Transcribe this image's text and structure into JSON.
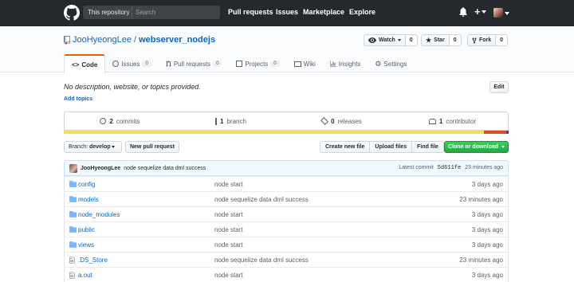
{
  "header": {
    "search_scope": "This repository",
    "search_placeholder": "Search",
    "nav": [
      "Pull requests",
      "Issues",
      "Marketplace",
      "Explore"
    ],
    "plus": "+"
  },
  "repo": {
    "owner": "JooHyeongLee",
    "separator": "/",
    "name": "webserver_nodejs",
    "watch_label": "Watch",
    "watch_count": "0",
    "star_label": "Star",
    "star_count": "0",
    "fork_label": "Fork",
    "fork_count": "0"
  },
  "tabs": [
    {
      "label": "Code",
      "icon": "code-icon",
      "counter": ""
    },
    {
      "label": "Issues",
      "icon": "issue-icon",
      "counter": "0"
    },
    {
      "label": "Pull requests",
      "icon": "pull-request-icon",
      "counter": "0"
    },
    {
      "label": "Projects",
      "icon": "project-icon",
      "counter": "0"
    },
    {
      "label": "Wiki",
      "icon": "book-icon",
      "counter": ""
    },
    {
      "label": "Insights",
      "icon": "graph-icon",
      "counter": ""
    },
    {
      "label": "Settings",
      "icon": "gear-icon",
      "counter": ""
    }
  ],
  "description": "No description, website, or topics provided.",
  "add_topics": "Add topics",
  "edit_label": "Edit",
  "summary": {
    "commits_num": "2",
    "commits_label": "commits",
    "branches_num": "1",
    "branches_label": "branch",
    "releases_num": "0",
    "releases_label": "releases",
    "contributors_num": "1",
    "contributors_label": "contributor"
  },
  "languages": [
    {
      "color": "#f1e05a",
      "share": 0.945
    },
    {
      "color": "#e34c26",
      "share": 0.05
    },
    {
      "color": "#563d7c",
      "share": 0.005
    }
  ],
  "file_nav": {
    "branch_prefix": "Branch:",
    "branch_name": "develop",
    "new_pr": "New pull request",
    "create_file": "Create new file",
    "upload_files": "Upload files",
    "find_file": "Find file",
    "clone": "Clone or download"
  },
  "commit": {
    "author": "JooHyeongLee",
    "message": "node sequelize data dml success",
    "latest_label": "Latest commit",
    "sha": "5d611fe",
    "age": "23 minutes ago"
  },
  "files": [
    {
      "name": "config",
      "type": "dir",
      "message": "node start",
      "age": "3 days ago"
    },
    {
      "name": "models",
      "type": "dir",
      "message": "node sequelize data dml success",
      "age": "23 minutes ago"
    },
    {
      "name": "node_modules",
      "type": "dir",
      "message": "node start",
      "age": "3 days ago"
    },
    {
      "name": "public",
      "type": "dir",
      "message": "node start",
      "age": "3 days ago"
    },
    {
      "name": "views",
      "type": "dir",
      "message": "node start",
      "age": "3 days ago"
    },
    {
      "name": ".DS_Store",
      "type": "file",
      "message": "node sequelize data dml success",
      "age": "23 minutes ago"
    },
    {
      "name": "a.out",
      "type": "file",
      "message": "node start",
      "age": "3 days ago"
    }
  ]
}
